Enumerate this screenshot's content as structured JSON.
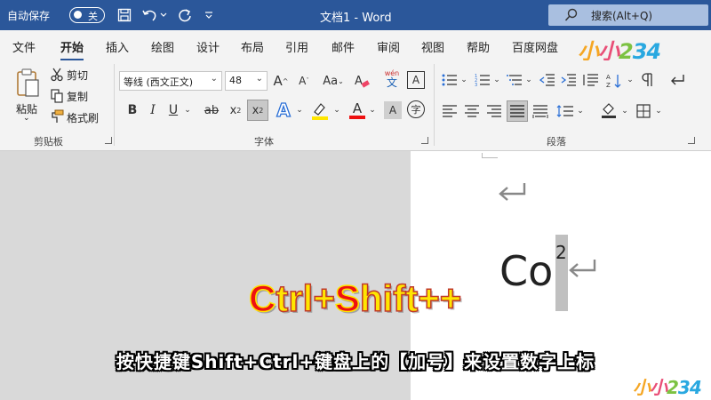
{
  "titlebar": {
    "autosave_label": "自动保存",
    "autosave_state": "关",
    "doc_title": "文档1  -  Word",
    "search_placeholder": "搜索(Alt+Q)"
  },
  "tabs": [
    "文件",
    "开始",
    "插入",
    "绘图",
    "设计",
    "布局",
    "引用",
    "邮件",
    "审阅",
    "视图",
    "帮助",
    "百度网盘"
  ],
  "active_tab": "开始",
  "watermark": "小小234",
  "clipboard": {
    "paste_label": "粘贴",
    "cut_label": "剪切",
    "copy_label": "复制",
    "format_painter_label": "格式刷",
    "group_label": "剪贴板"
  },
  "font": {
    "font_name": "等线 (西文正文)",
    "font_size": "48",
    "group_label": "字体",
    "phonetic_top": "wén",
    "phonetic_bottom": "文"
  },
  "paragraph": {
    "group_label": "段落"
  },
  "document": {
    "base_text": "Co",
    "superscript": "2"
  },
  "overlay": {
    "shortcut_part1": "C",
    "shortcut_part2": "trl+",
    "shortcut_part3": "S",
    "shortcut_part4": "hift++",
    "caption": "按快捷键Shift+Ctrl+键盘上的【加号】来设置数字上标"
  },
  "colors": {
    "titlebar": "#2b579a",
    "ribbon": "#f3f3f3",
    "highlight": "#ffe600",
    "font_color": "#e11"
  }
}
